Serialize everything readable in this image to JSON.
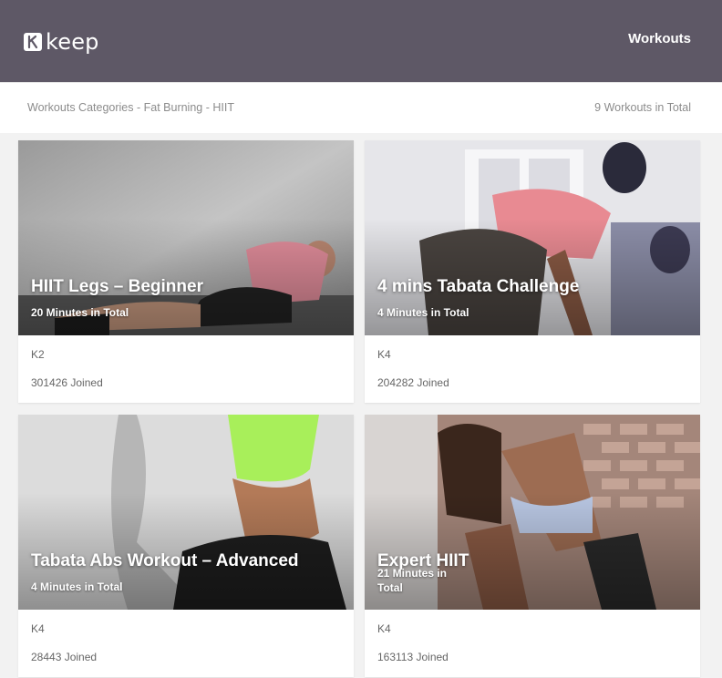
{
  "header": {
    "logo_text": "keep",
    "logo_icon": "keep-k-icon",
    "nav_workouts": "Workouts",
    "background": "#5e5866"
  },
  "breadcrumb": {
    "items": [
      "Workouts Categories",
      "Fat Burning",
      "HIIT"
    ],
    "separator": "-",
    "total": "9 Workouts in Total"
  },
  "workouts": [
    {
      "title": "HIIT Legs – Beginner",
      "duration": "20 Minutes in Total",
      "level": "K2",
      "joined": "301426 Joined"
    },
    {
      "title": "4 mins Tabata Challenge",
      "duration": "4 Minutes in Total",
      "level": "K4",
      "joined": "204282 Joined"
    },
    {
      "title": "Tabata Abs Workout – Advanced",
      "duration": "4 Minutes in Total",
      "level": "K4",
      "joined": "28443 Joined"
    },
    {
      "title": "Expert HIIT",
      "duration": "21 Minutes in Total",
      "level": "K4",
      "joined": "163113 Joined"
    }
  ]
}
